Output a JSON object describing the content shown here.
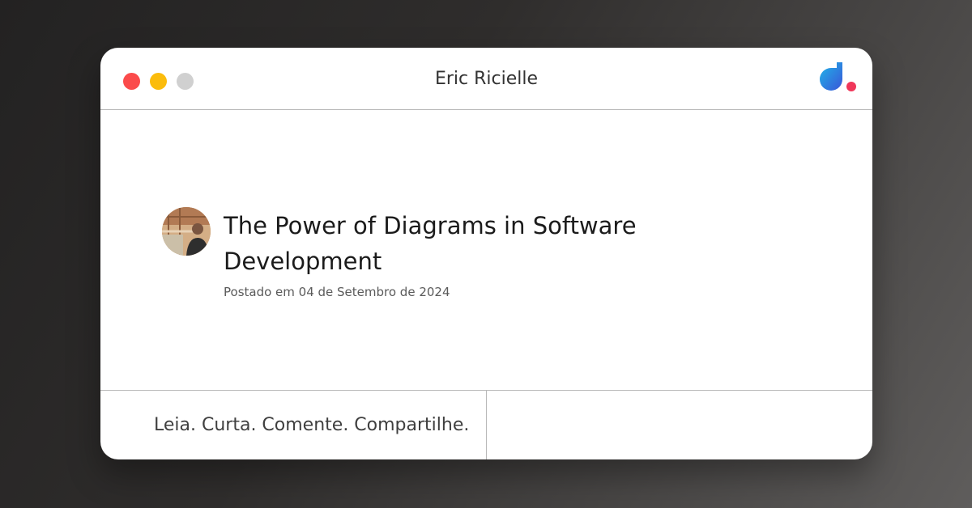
{
  "window": {
    "title": "Eric Ricielle",
    "controls": [
      "close",
      "minimize",
      "zoom"
    ],
    "brand_icon": "brand-logo-icon",
    "colors": {
      "close": "#fb4b4b",
      "minimize": "#fbbc0c",
      "zoom": "#d0d0d0",
      "logo_gradient_start": "#1fb6e8",
      "logo_gradient_end": "#3a55d8",
      "logo_dot": "#f0375a"
    }
  },
  "post": {
    "title": "The Power of Diagrams in Software Development",
    "date": "Postado em 04 de Setembro de 2024",
    "avatar_icon": "author-avatar"
  },
  "footer": {
    "tagline": "Leia. Curta. Comente. Compartilhe."
  }
}
